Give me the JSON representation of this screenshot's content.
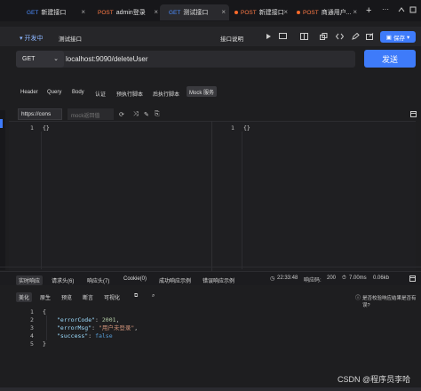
{
  "tabs": [
    {
      "method": "GET",
      "title": "新建接口",
      "method_color": "#4c8dff",
      "dot": false
    },
    {
      "method": "POST",
      "title": "admin登录",
      "method_color": "#ff7a45",
      "dot": false
    },
    {
      "method": "GET",
      "title": "测试接口",
      "method_color": "#4c8dff",
      "dot": false
    },
    {
      "method": "POST",
      "title": "新建接口",
      "method_color": "#ff7a45",
      "dot": true
    },
    {
      "method": "POST",
      "title": "商通用户...",
      "method_color": "#ff7a45",
      "dot": true
    }
  ],
  "env": {
    "label": "开发中"
  },
  "request": {
    "name": "测试接口",
    "doc_label": "接口说明",
    "save_label": "保存",
    "method": "GET",
    "url": "localhost:9090/deleteUser",
    "send_label": "发送"
  },
  "request_tabs": [
    "Header",
    "Query",
    "Body",
    "认证",
    "预执行脚本",
    "后执行脚本",
    "Mock 服务"
  ],
  "editor": {
    "url_mode": "https://cons",
    "mock_placeholder": "mock返回值",
    "left_line": "1",
    "left_code": "{}",
    "right_line": "1",
    "right_code": "{}"
  },
  "response_tabs": [
    {
      "label": "实时响应",
      "active": true
    },
    {
      "label": "请求头(6)",
      "active": false
    },
    {
      "label": "响应头(7)",
      "active": false
    },
    {
      "label": "Cookie(0)",
      "active": false
    },
    {
      "label": "成功响应示例",
      "active": false
    },
    {
      "label": "错误响应示例",
      "active": false
    }
  ],
  "status": {
    "time": "22:33:48",
    "code_label": "响应码:",
    "code": "200",
    "duration": "7.00ms",
    "size": "0.06kb"
  },
  "format_tabs": [
    "美化",
    "原生",
    "预览",
    "断言",
    "可视化"
  ],
  "assert_hint": "是否校验响应结果是否有误?",
  "response_body": {
    "lines": [
      "1",
      "2",
      "3",
      "4",
      "5"
    ],
    "errorCode_key": "\"errorCode\"",
    "errorCode_val": "2001",
    "errorMsg_key": "\"errorMsg\"",
    "errorMsg_val": "\"用户未登录\"",
    "success_key": "\"success\"",
    "success_val": "false"
  },
  "watermark": "CSDN @程序员李哈",
  "colors": {
    "accent": "#3e7bfa",
    "success": "#3fbd6d",
    "get": "#4c8dff",
    "post": "#ff7a45"
  }
}
